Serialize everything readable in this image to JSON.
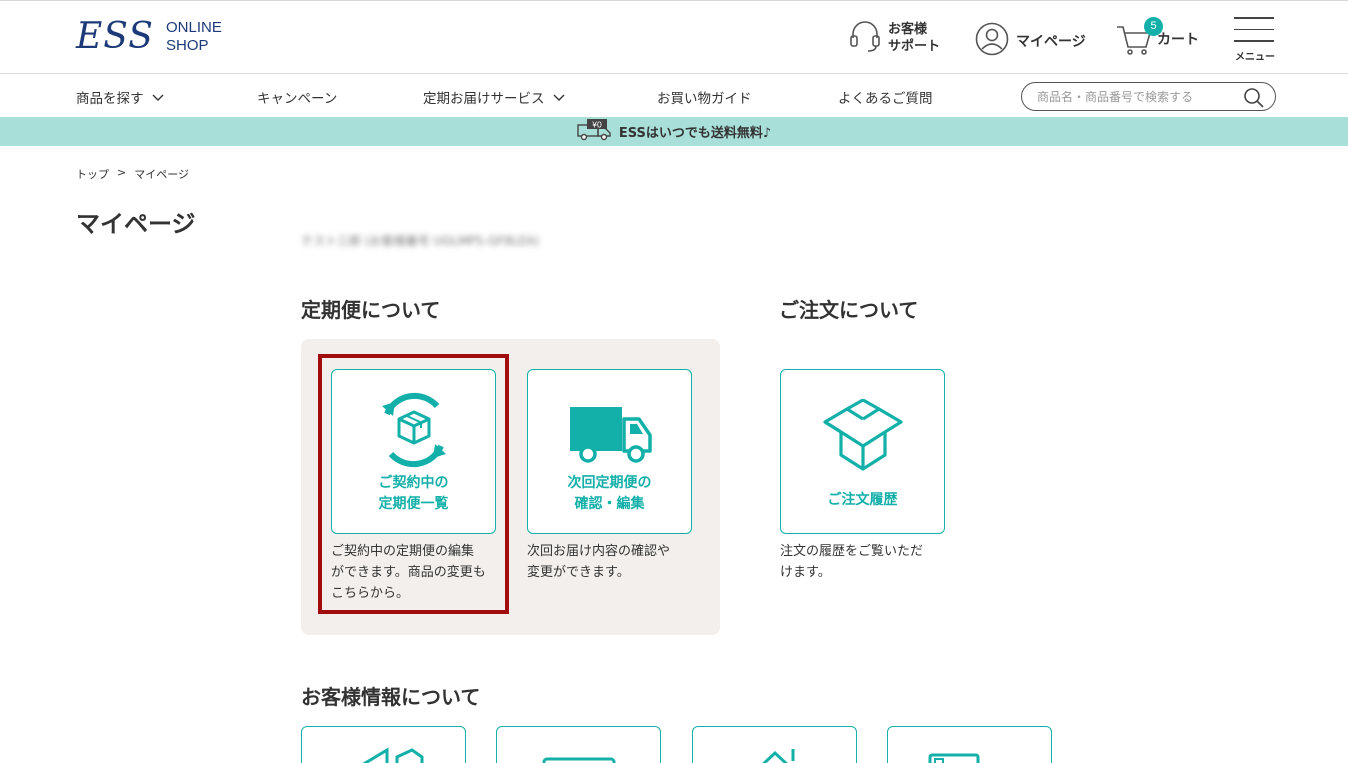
{
  "header": {
    "logo_main": "ESS",
    "logo_line1": "ONLINE",
    "logo_line2": "SHOP",
    "support_line1": "お客様",
    "support_line2": "サポート",
    "mypage": "マイページ",
    "cart_label": "カート",
    "cart_count": "5",
    "menu_label": "メニュー"
  },
  "nav": {
    "items": [
      "商品を探す",
      "キャンペーン",
      "定期お届けサービス",
      "お買い物ガイド",
      "よくあるご質問"
    ],
    "search_placeholder": "商品名・商品番号で検索する"
  },
  "banner": {
    "price_tag": "¥0",
    "text": "ESSはいつでも送料無料♪"
  },
  "breadcrumb": [
    "トップ",
    ">",
    "マイページ"
  ],
  "page_title": "マイページ",
  "user_info_blurred": "テスト三郎 (お客様番号 UGLMP5-GF8LEA)",
  "sections": {
    "subscription_title": "定期便について",
    "order_title": "ご注文について",
    "customer_title": "お客様情報について"
  },
  "cards": {
    "subscription_list": {
      "line1": "ご契約中の",
      "line2": "定期便一覧",
      "desc1": "ご契約中の定期便の編集",
      "desc2": "ができます。商品の変更も",
      "desc3": "こちらから。"
    },
    "next_delivery": {
      "line1": "次回定期便の",
      "line2": "確認・編集",
      "desc1": "次回お届け内容の確認や",
      "desc2": "変更ができます。"
    },
    "order_history": {
      "line1": "ご注文履歴",
      "desc1": "注文の履歴をご覧いただ",
      "desc2": "けます。"
    }
  },
  "colors": {
    "brand_navy": "#1d3a78",
    "accent_teal": "#13b0a9",
    "banner_bg": "#a9dfd9",
    "panel_bg": "#f2efec",
    "highlight": "#a10d0d"
  }
}
